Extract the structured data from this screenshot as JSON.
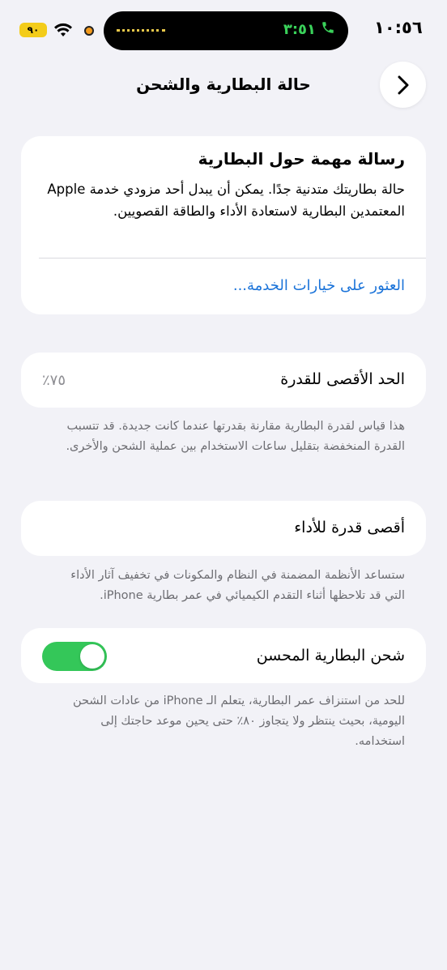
{
  "status_bar": {
    "time": "١٠:٥٦",
    "call_timer": "٣:٥١",
    "battery_level": "٩٠",
    "battery_color": "#f3cc1a",
    "call_color": "#3ad15a"
  },
  "nav": {
    "title": "حالة البطارية والشحن",
    "back_icon": "chevron-right-icon"
  },
  "message_card": {
    "title": "رسالة مهمة حول البطارية",
    "body": "حالة بطاريتك متدنية جدًا. يمكن أن يبدل أحد مزودي خدمة Apple المعتمدين البطارية لاستعادة الأداء والطاقة القصويين.",
    "link": "العثور على خيارات الخدمة..."
  },
  "max_capacity": {
    "label": "الحد الأقصى للقدرة",
    "value": "٪٧٥",
    "footnote": "هذا قياس لقدرة البطارية مقارنة بقدرتها عندما كانت جديدة. قد تتسبب القدرة المنخفضة بتقليل ساعات الاستخدام بين عملية الشحن والأخرى."
  },
  "peak_performance": {
    "label": "أقصى قدرة للأداء",
    "footnote": "ستساعد الأنظمة المضمنة في النظام والمكونات في تخفيف آثار الأداء التي قد تلاحظها أثناء التقدم الكيميائي في عمر بطارية iPhone."
  },
  "optimized_charging": {
    "label": "شحن البطارية المحسن",
    "enabled": true,
    "toggle_color": "#34c759",
    "footnote": "للحد من استنزاف عمر البطارية، يتعلم الـ iPhone من عادات الشحن اليومية، بحيث ينتظر ولا يتجاوز ٨٠٪ حتى يحين موعد حاجتك إلى استخدامه."
  },
  "colors": {
    "background": "#f2f2f7",
    "link": "#1a73d9"
  }
}
